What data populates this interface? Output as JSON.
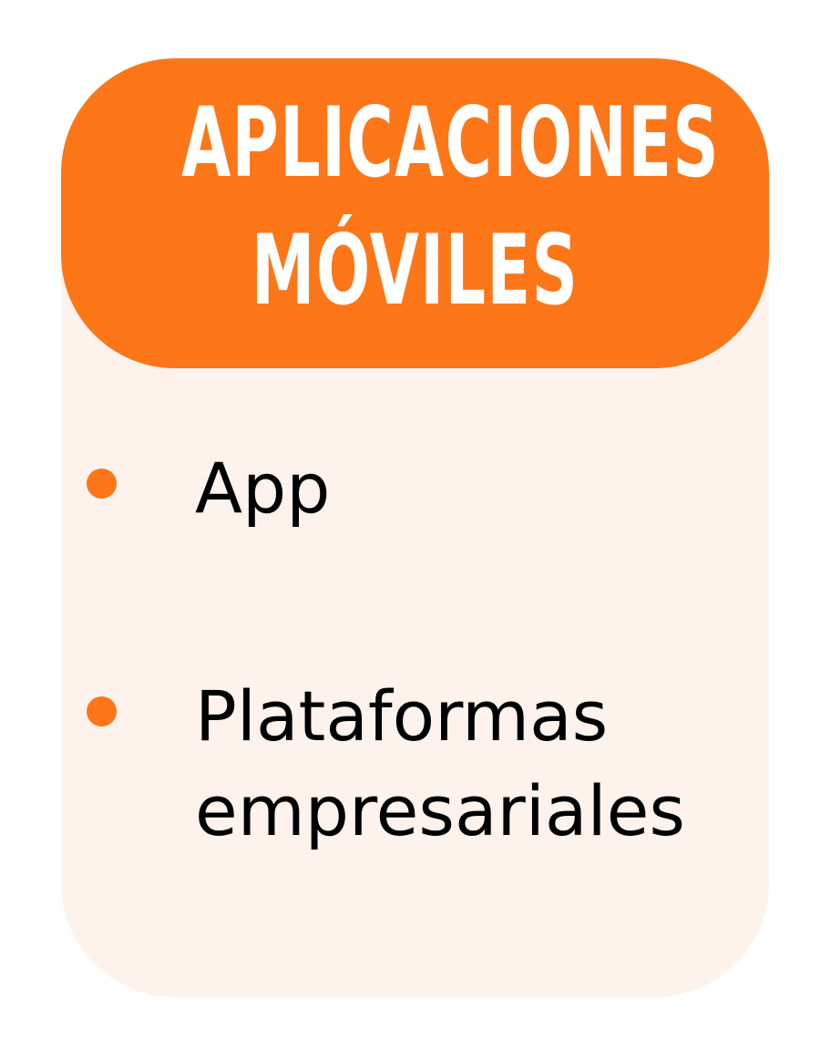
{
  "colors": {
    "accent": "#fd7618",
    "panel_background": "#fdf3ec",
    "text": "#000000",
    "title_text": "#ffffff"
  },
  "header": {
    "title_line1": "APLICACIONES",
    "title_line2": "MÓVILES"
  },
  "list": {
    "items": [
      {
        "label": "App"
      },
      {
        "label": "Plataformas empresariales"
      }
    ]
  }
}
